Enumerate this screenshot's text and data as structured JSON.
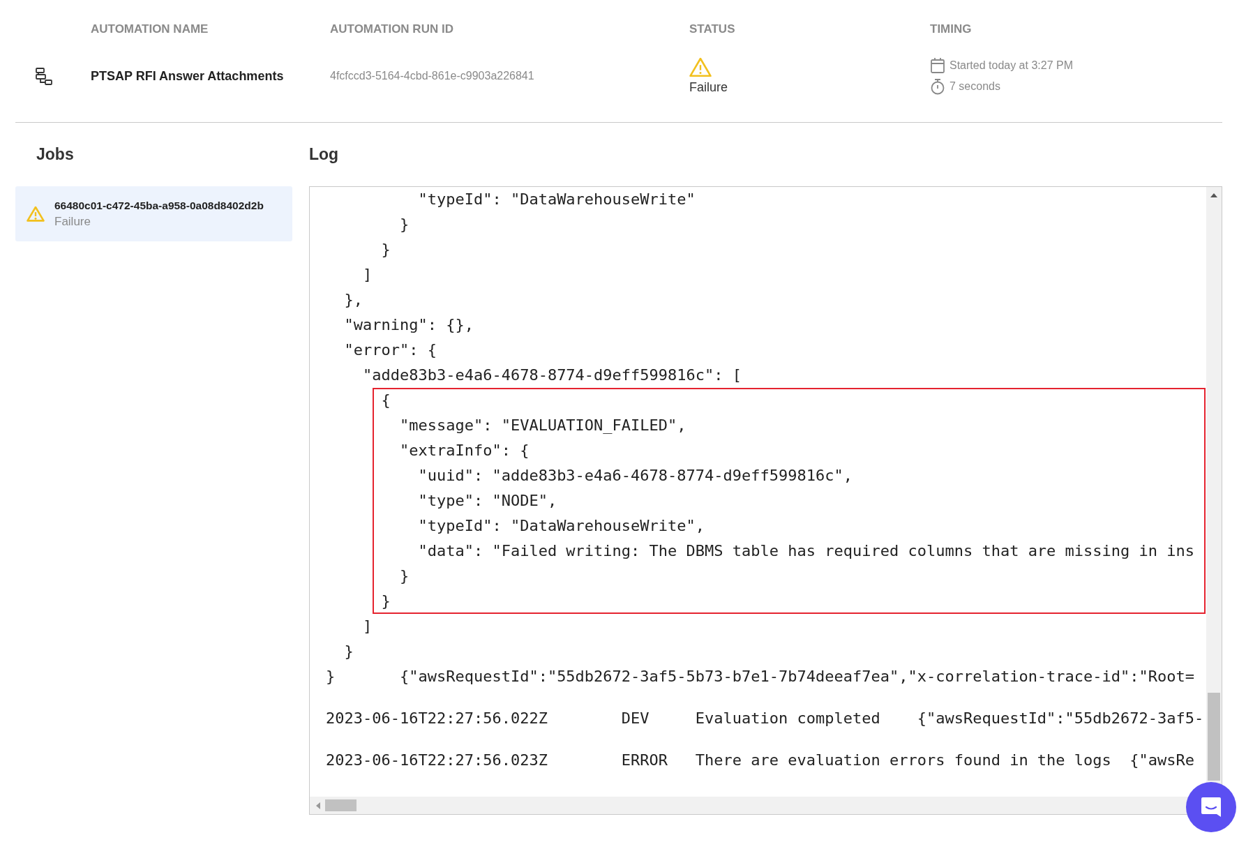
{
  "header": {
    "columns": [
      "AUTOMATION NAME",
      "AUTOMATION RUN ID",
      "STATUS",
      "TIMING"
    ]
  },
  "run": {
    "name": "PTSAP RFI Answer Attachments",
    "run_id": "4fcfccd3-5164-4cbd-861e-c9903a226841",
    "status": {
      "kind": "failure",
      "label": "Failure"
    },
    "timing": {
      "started": "Started today at 3:27 PM",
      "duration": "7 seconds"
    }
  },
  "jobs": {
    "title": "Jobs",
    "items": [
      {
        "id": "66480c01-c472-45ba-a958-0a08d8402d2b",
        "kind": "failure",
        "status_label": "Failure",
        "selected": true
      }
    ]
  },
  "log": {
    "title": "Log",
    "blocks": [
      {
        "kind": "plain",
        "lines": [
          "          \"typeId\": \"DataWarehouseWrite\"",
          "        }",
          "      }",
          "    ]",
          "  },",
          "  \"warning\": {},",
          "  \"error\": {",
          "    \"adde83b3-e4a6-4678-8774-d9eff599816c\": ["
        ]
      },
      {
        "kind": "highlight",
        "lines": [
          "      {",
          "        \"message\": \"EVALUATION_FAILED\",",
          "        \"extraInfo\": {",
          "          \"uuid\": \"adde83b3-e4a6-4678-8774-d9eff599816c\",",
          "          \"type\": \"NODE\",",
          "          \"typeId\": \"DataWarehouseWrite\",",
          "          \"data\": \"Failed writing: The DBMS table has required columns that are missing in ins",
          "        }",
          "      }"
        ]
      },
      {
        "kind": "plain",
        "lines": [
          "    ]",
          "  }",
          "}       {\"awsRequestId\":\"55db2672-3af5-5b73-b7e1-7b74deeaf7ea\",\"x-correlation-trace-id\":\"Root="
        ]
      },
      {
        "kind": "entries",
        "lines": [
          "2023-06-16T22:27:56.022Z        DEV     Evaluation completed    {\"awsRequestId\":\"55db2672-3af5-",
          "2023-06-16T22:27:56.023Z        ERROR   There are evaluation errors found in the logs  {\"awsRe"
        ]
      }
    ]
  }
}
